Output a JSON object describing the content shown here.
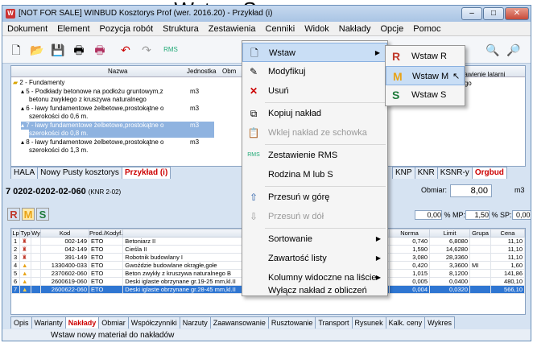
{
  "caption": "• Wstaw S",
  "window": {
    "title": "[NOT FOR SALE] WINBUD Kosztorys Prof (wer. 2016.20) - Przykład (i)",
    "min": "–",
    "max": "□",
    "close": "✕"
  },
  "menubar": [
    "Dokument",
    "Element",
    "Pozycja robót",
    "Struktura",
    "Zestawienia",
    "Cenniki",
    "Widok",
    "Nakłady",
    "Opcje",
    "Pomoc"
  ],
  "tree": {
    "headers": [
      "Nazwa",
      "Jednostka",
      "Obm"
    ],
    "rows": [
      {
        "text": "2 - Fundamenty",
        "unit": ""
      },
      {
        "text": "5 - Podkłady betonowe na podłożu gruntowym,z",
        "unit": "m3"
      },
      {
        "text": "betonu zwykłego z kruszywa naturalnego",
        "unit": ""
      },
      {
        "text": "6 - ławy fundamentowe żelbetowe,prostokątne o",
        "unit": "m3"
      },
      {
        "text": "szerokości do 0,6 m.",
        "unit": ""
      },
      {
        "text": "7 - ławy fundamentowe żelbetowe,prostokątne o",
        "unit": "m3"
      },
      {
        "text": "szerokości do 0,8 m.",
        "unit": ""
      },
      {
        "text": "8 - ławy fundamentowe żelbetowe,prostokątne o",
        "unit": "m3"
      },
      {
        "text": "szerokości do 1,3 m.",
        "unit": ""
      }
    ],
    "hint": "...wego. ...tarni oś- ...i ustawienie latarni oświetlenia solarnego i ...go"
  },
  "tabs_top": [
    "HALA",
    "Nowy Pusty kosztorys",
    "Przykład (i)"
  ],
  "tabs_top_right": [
    "KNP",
    "KNR",
    "KSNR-y",
    "Orgbud"
  ],
  "position": {
    "code": "7  0202-0202-02-060",
    "ref": "(KNR 2-02)"
  },
  "measure": {
    "label": "Obmiar:",
    "value": "8,00",
    "unit": "m3"
  },
  "rms": [
    "R",
    "M",
    "S"
  ],
  "percents": [
    {
      "label": "",
      "value": "0,00"
    },
    {
      "label": "MP:",
      "value": "1,50"
    },
    {
      "label": "SP:",
      "value": "0,00"
    }
  ],
  "grid": {
    "headers": [
      "Lp",
      "Typ",
      "Wy",
      "Kod",
      "Prod./Kodyf.",
      "Nazwa",
      "Norma",
      "Limit",
      "Grupa",
      "Cena"
    ],
    "rows": [
      {
        "lp": "1",
        "kod": "002-149",
        "prod": "ETO",
        "name": "Betoniarz II",
        "norma": "0,740",
        "limit": "6,8080",
        "grupa": "",
        "cena": "11,10"
      },
      {
        "lp": "2",
        "kod": "042-149",
        "prod": "ETO",
        "name": "Cieśla II",
        "norma": "1,590",
        "limit": "14,6280",
        "grupa": "",
        "cena": "11,10"
      },
      {
        "lp": "3",
        "kod": "391-149",
        "prod": "ETO",
        "name": "Robotnik budowlany I",
        "norma": "3,080",
        "limit": "28,3360",
        "grupa": "",
        "cena": "11,10"
      },
      {
        "lp": "4",
        "kod": "1330400-033",
        "prod": "ETO",
        "name": "Gwoździe budowlane okrągłe,gołe",
        "norma": "0,420",
        "limit": "3,3600",
        "grupa": "MI",
        "cena": "1,60"
      },
      {
        "lp": "5",
        "kod": "2370602-060",
        "prod": "ETO",
        "name": "Beton zwykły z kruszywa naturalnego B",
        "norma": "1,015",
        "limit": "8,1200",
        "grupa": "",
        "cena": "141,86"
      },
      {
        "lp": "6",
        "kod": "2600619-060",
        "prod": "ETO",
        "name": "Deski iglaste obrzynane gr.19-25 mm,kl.II",
        "norma": "0,005",
        "limit": "0,0400",
        "grupa": "",
        "cena": "480,10"
      },
      {
        "lp": "7",
        "kod": "2600622-060",
        "prod": "ETO",
        "name": "Deski iglaste obrzynane gr.28-45 mm,kl.II",
        "norma": "0,004",
        "limit": "0,0320",
        "grupa": "",
        "cena": "566,10"
      }
    ]
  },
  "tabs_bottom": [
    "Opis",
    "Warianty",
    "Nakłady",
    "Obmiar",
    "Współczynniki",
    "Narzuty",
    "Zaawansowanie",
    "Rusztowanie",
    "Transport",
    "Rysunek",
    "Kalk. ceny",
    "Wykres"
  ],
  "status": "Wstaw nowy materiał do nakładów",
  "context_menu": [
    {
      "label": "Wstaw",
      "sub": true,
      "hl": true
    },
    {
      "label": "Modyfikuj"
    },
    {
      "label": "Usuń"
    },
    {
      "label": "Kopiuj nakład"
    },
    {
      "label": "Wklej nakład ze schowka",
      "dis": true
    },
    {
      "label": "Zestawienie RMS"
    },
    {
      "label": "Rodzina M lub S"
    },
    {
      "label": "Przesuń w górę"
    },
    {
      "label": "Przesuń w dół",
      "dis": true
    },
    {
      "label": "Sortowanie",
      "sub": true
    },
    {
      "label": "Zawartość listy",
      "sub": true
    },
    {
      "label": "Kolumny widoczne na liście",
      "sub": true
    },
    {
      "label": "Wyłącz nakład z obliczeń"
    }
  ],
  "submenu": [
    {
      "letter": "R",
      "label": "Wstaw R"
    },
    {
      "letter": "M",
      "label": "Wstaw M",
      "hl": true
    },
    {
      "letter": "S",
      "label": "Wstaw S"
    }
  ],
  "colors": {
    "R": "#c0392b",
    "M": "#e8a317",
    "S": "#1e7a3a"
  }
}
